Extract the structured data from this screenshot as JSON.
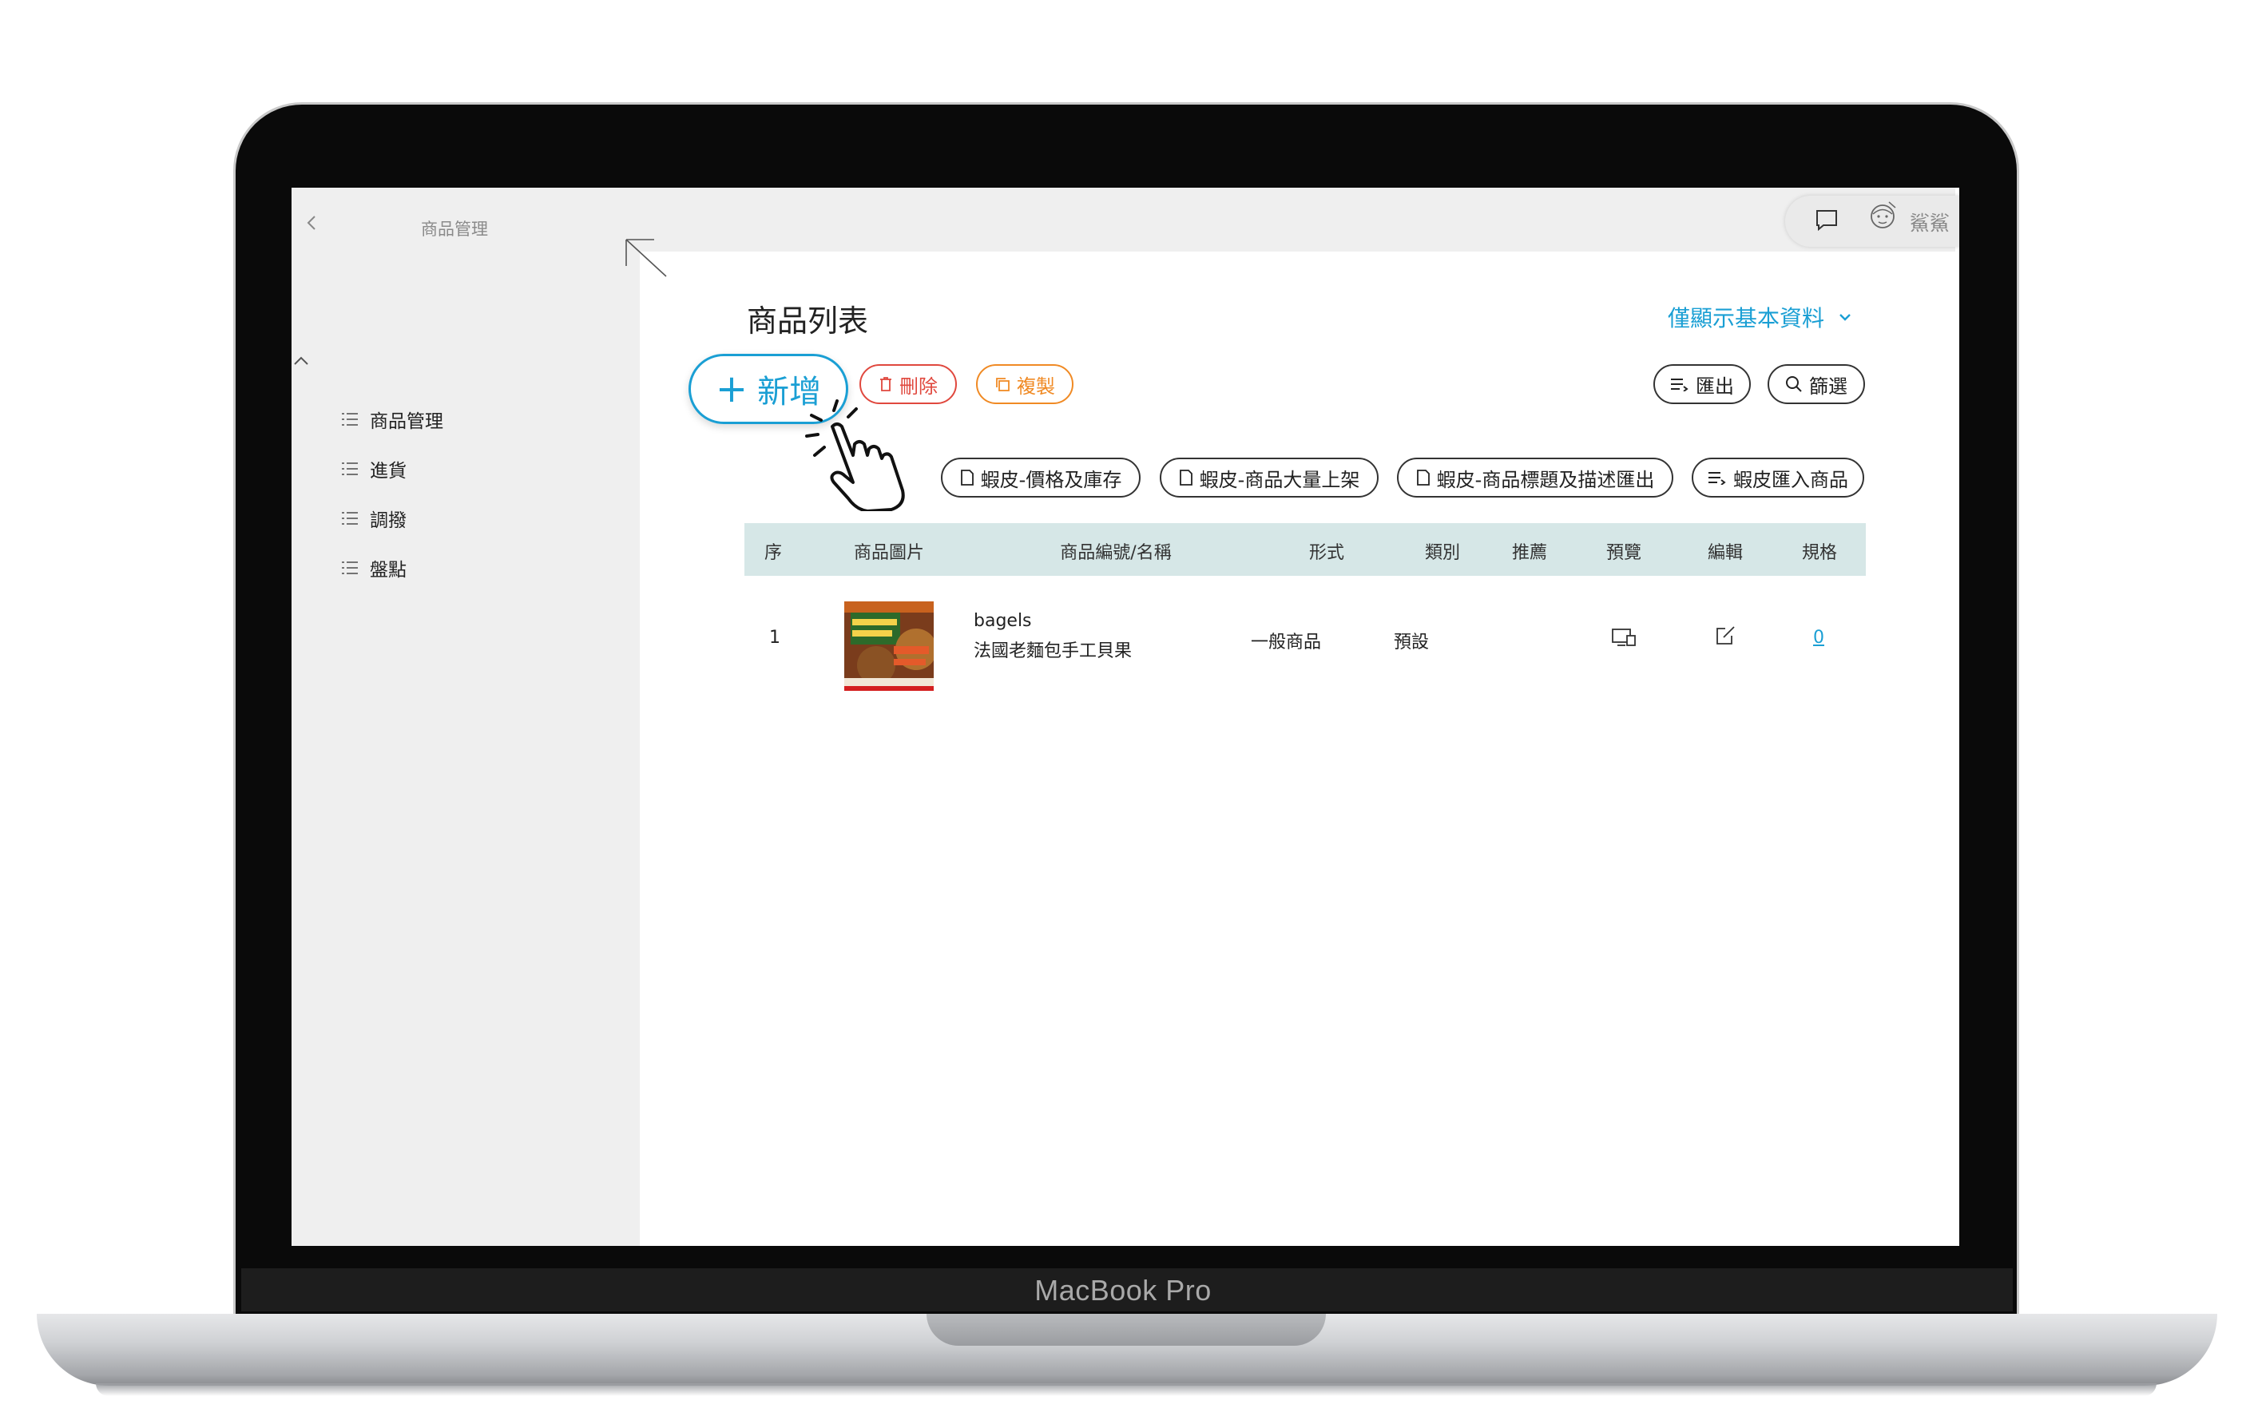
{
  "device": {
    "brand": "MacBook Pro"
  },
  "sidebar": {
    "title": "商品管理",
    "items": [
      {
        "label": "商品管理"
      },
      {
        "label": "進貨"
      },
      {
        "label": "調撥"
      },
      {
        "label": "盤點"
      }
    ]
  },
  "header": {
    "user_name": "鯊鯊"
  },
  "page": {
    "title": "商品列表",
    "view_toggle": "僅顯示基本資料"
  },
  "toolbar": {
    "add_label": "新增",
    "delete_label": "刪除",
    "copy_label": "複製",
    "export_label": "匯出",
    "filter_label": "篩選",
    "shopee_price_stock": "蝦皮-價格及庫存",
    "shopee_bulk_list": "蝦皮-商品大量上架",
    "shopee_title_desc_export": "蝦皮-商品標題及描述匯出",
    "shopee_import": "蝦皮匯入商品"
  },
  "table": {
    "headers": [
      "序",
      "商品圖片",
      "商品編號/名稱",
      "形式",
      "類別",
      "推薦",
      "預覽",
      "編輯",
      "規格"
    ],
    "rows": [
      {
        "index": "1",
        "code": "bagels",
        "name": "法國老麵包手工貝果",
        "type": "一般商品",
        "category": "預設",
        "recommend": "",
        "spec_count": "0"
      }
    ]
  },
  "colors": {
    "accent": "#1a9fd4",
    "danger": "#e0483e",
    "warning": "#f08a24",
    "table_header_bg": "#d6e7e7",
    "sidebar_bg": "#efefef"
  },
  "icons": [
    "back-icon",
    "list-icon",
    "resize-icon",
    "chat-icon",
    "avatar",
    "chevron-down-icon",
    "trash-icon",
    "copy-icon",
    "export-icon",
    "search-icon",
    "document-icon",
    "import-icon",
    "preview-icon",
    "edit-icon",
    "pointer-hand-icon"
  ]
}
